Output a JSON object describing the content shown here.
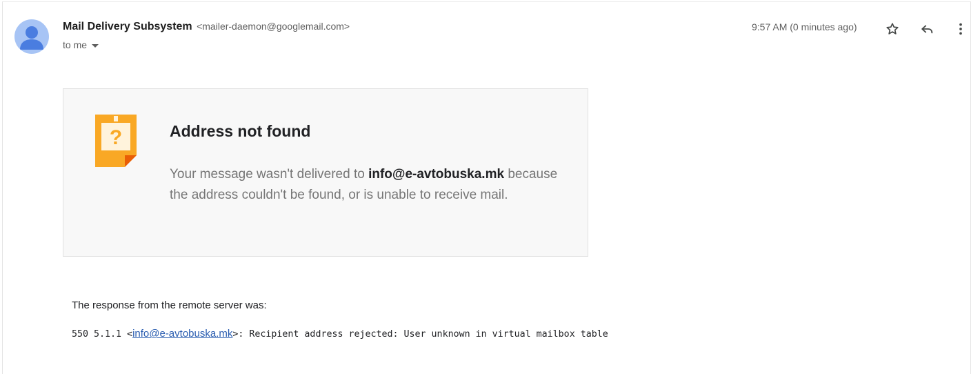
{
  "header": {
    "sender_name": "Mail Delivery Subsystem",
    "sender_email": "<mailer-daemon@googlemail.com>",
    "recipient": "to me",
    "time": "9:57 AM (0 minutes ago)",
    "icons": [
      "person-avatar-icon",
      "star-icon",
      "reply-icon",
      "more-vert-icon",
      "caret-down-icon"
    ]
  },
  "card": {
    "icon": "question-note-icon",
    "title": "Address not found",
    "body_prefix": "Your message wasn't delivered to ",
    "address": "info@e-avtobuska.mk",
    "body_suffix": " because the address couldn't be found, or is unable to receive mail."
  },
  "response": {
    "label": "The response from the remote server was:",
    "code_prefix": "550 5.1.1 <",
    "address_link": "info@e-avtobuska.mk",
    "code_suffix": ">: Recipient address rejected: User unknown in virtual mailbox table"
  },
  "colors": {
    "avatar_bg": "#a7c4f5",
    "avatar_fg": "#4a7de0",
    "note_orange": "#f9a825",
    "link": "#2a5db0"
  }
}
